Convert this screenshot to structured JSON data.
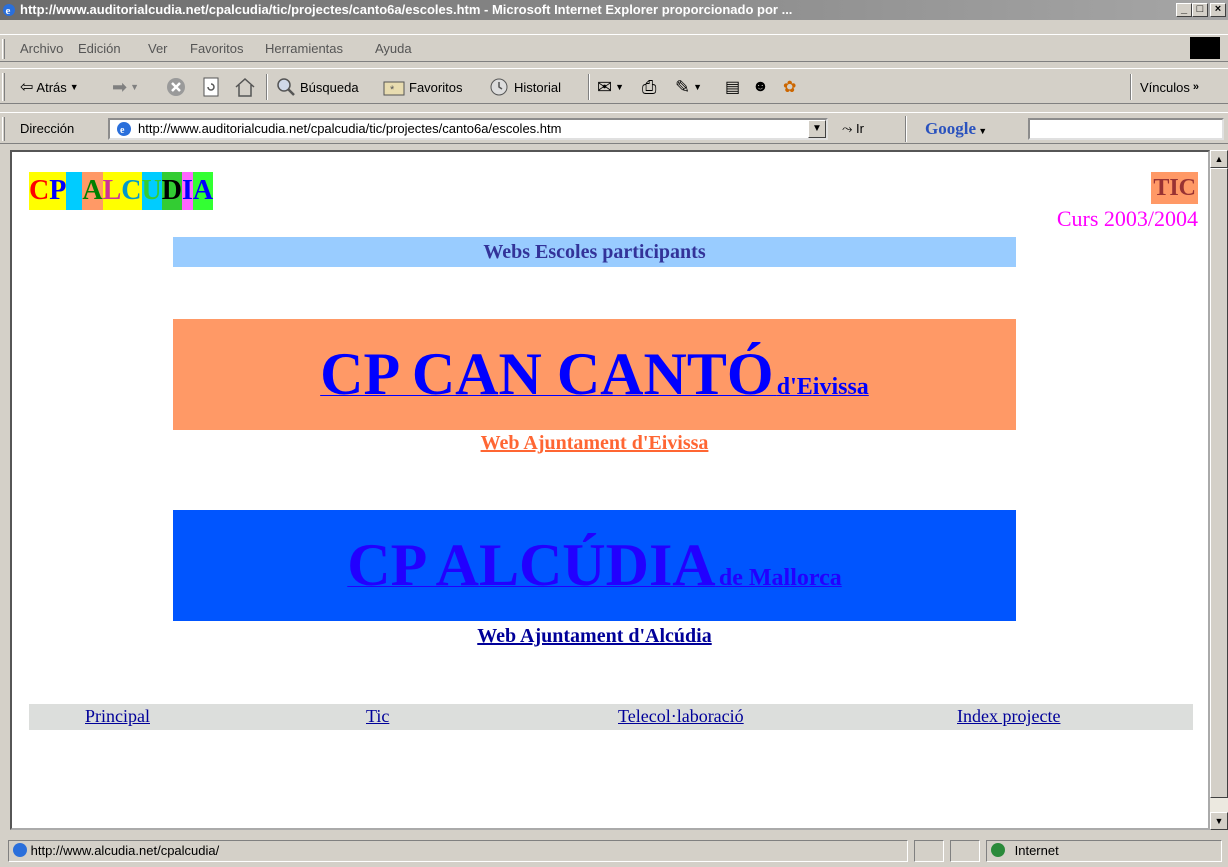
{
  "window": {
    "title": "http://www.auditorialcudia.net/cpalcudia/tic/projectes/canto6a/escoles.htm - Microsoft Internet Explorer proporcionado por ...",
    "controls": {
      "minimize": "_",
      "maximize": "□",
      "close": "×"
    }
  },
  "menu": [
    "Archivo",
    "Edición",
    "Ver",
    "Favoritos",
    "Herramientas",
    "Ayuda"
  ],
  "toolbar": {
    "back": "Atrás",
    "search": "Búsqueda",
    "favorites": "Favoritos",
    "history": "Historial",
    "links": "Vínculos"
  },
  "address": {
    "label": "Dirección",
    "url": "http://www.auditorialcudia.net/cpalcudia/tic/projectes/canto6a/escoles.htm",
    "go": "Ir",
    "google": "Google"
  },
  "page": {
    "logo_letters": [
      {
        "char": "C",
        "bg": "#ffff00",
        "fg": "#ff0000"
      },
      {
        "char": "P",
        "bg": "#ffff00",
        "fg": "#0000ff"
      },
      {
        "char": " ",
        "bg": "#00ccff",
        "fg": "#000000"
      },
      {
        "char": "A",
        "bg": "#ff9966",
        "fg": "#008000"
      },
      {
        "char": "L",
        "bg": "#ffff00",
        "fg": "#cc3399"
      },
      {
        "char": "C",
        "bg": "#ffff00",
        "fg": "#0099cc"
      },
      {
        "char": "U",
        "bg": "#00ccff",
        "fg": "#33cc33"
      },
      {
        "char": "D",
        "bg": "#33cc33",
        "fg": "#000000"
      },
      {
        "char": "I",
        "bg": "#ff66ff",
        "fg": "#0000ff"
      },
      {
        "char": "A",
        "bg": "#33ff33",
        "fg": "#0000ff"
      }
    ],
    "tic": "TIC",
    "course": "Curs 2003/2004",
    "heading": "Webs Escoles participants",
    "school1": {
      "name": "CP CAN CANTÓ",
      "place": "d'Eivissa",
      "link": "Web Ajuntament d'Eivissa"
    },
    "school2": {
      "name": "CP ALCÚDIA",
      "place": "de Mallorca",
      "link": "Web Ajuntament d'Alcúdia"
    },
    "footer": [
      "Principal",
      "Tic",
      "Telecol·laboració",
      "Index projecte"
    ]
  },
  "status": {
    "text": "http://www.alcudia.net/cpalcudia/",
    "zone": "Internet"
  },
  "colors": {
    "heading_bg": "#99ccff",
    "school1_bg": "#ff9966",
    "school2_bg": "#0055ff",
    "footer_bg": "#dcdedc",
    "course": "#ff00ff",
    "tic_bg": "#ff9966",
    "tic_fg": "#993333"
  }
}
